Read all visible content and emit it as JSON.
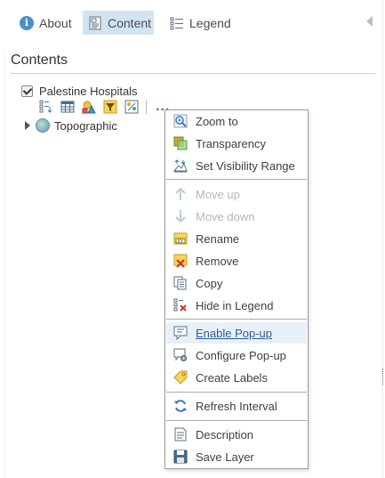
{
  "tabs": {
    "about": {
      "label": "About",
      "icon": "info-icon"
    },
    "content": {
      "label": "Content",
      "icon": "content-icon"
    },
    "legend": {
      "label": "Legend",
      "icon": "legend-icon"
    }
  },
  "section_title": "Contents",
  "layers": [
    {
      "name": "Palestine Hospitals",
      "checked": true
    },
    {
      "name": "Topographic",
      "icon": "globe-icon"
    }
  ],
  "layer_tools": [
    "show-legend-icon",
    "table-icon",
    "change-style-icon",
    "filter-icon",
    "analysis-icon"
  ],
  "more_options": "...",
  "menu": {
    "items": [
      {
        "label": "Zoom to",
        "icon": "zoom-to-icon",
        "enabled": true
      },
      {
        "label": "Transparency",
        "icon": "transparency-icon",
        "enabled": true
      },
      {
        "label": "Set Visibility Range",
        "icon": "visibility-range-icon",
        "enabled": true
      },
      {
        "label": "Move up",
        "icon": "move-up-icon",
        "enabled": false
      },
      {
        "label": "Move down",
        "icon": "move-down-icon",
        "enabled": false
      },
      {
        "label": "Rename",
        "icon": "rename-icon",
        "enabled": true
      },
      {
        "label": "Remove",
        "icon": "remove-icon",
        "enabled": true
      },
      {
        "label": "Copy",
        "icon": "copy-icon",
        "enabled": true
      },
      {
        "label": "Hide in Legend",
        "icon": "hide-in-legend-icon",
        "enabled": true
      },
      {
        "label": "Enable Pop-up",
        "icon": "enable-popup-icon",
        "enabled": true,
        "hovered": true
      },
      {
        "label": "Configure Pop-up",
        "icon": "configure-popup-icon",
        "enabled": true
      },
      {
        "label": "Create Labels",
        "icon": "create-labels-icon",
        "enabled": true
      },
      {
        "label": "Refresh Interval",
        "icon": "refresh-interval-icon",
        "enabled": true
      },
      {
        "label": "Description",
        "icon": "description-icon",
        "enabled": true
      },
      {
        "label": "Save Layer",
        "icon": "save-layer-icon",
        "enabled": true
      }
    ]
  },
  "colors": {
    "accent": "#3a78b5",
    "tab_active_bg": "#d2e4f2",
    "menu_hover_bg": "#e8f1f9"
  }
}
